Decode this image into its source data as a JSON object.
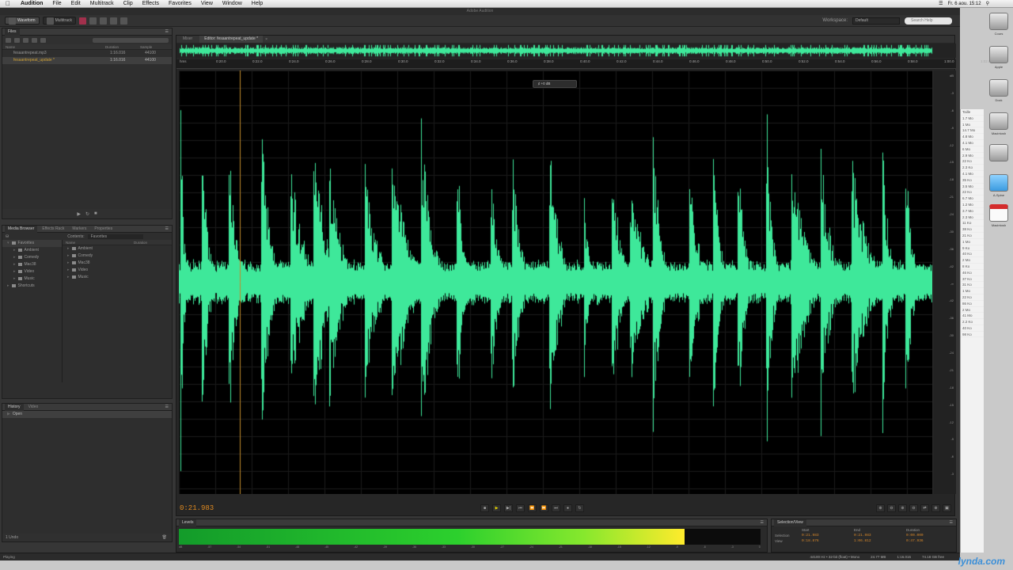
{
  "menubar": {
    "app": "Audition",
    "items": [
      "File",
      "Edit",
      "Multitrack",
      "Clip",
      "Effects",
      "Favorites",
      "View",
      "Window",
      "Help"
    ],
    "clock": "Fr. 6 aou. 15:12"
  },
  "window": {
    "title": "Adobe Audition"
  },
  "toolbar": {
    "waveform": "Waveform",
    "multitrack": "Multitrack",
    "workspace_label": "Workspace:",
    "workspace": "Default",
    "search_placeholder": "Search Help"
  },
  "files": {
    "title": "Files",
    "columns": {
      "name": "Name",
      "duration": "Duration",
      "rate": "Sample"
    },
    "rows": [
      {
        "name": "fesaantrepeat.mp3",
        "duration": "1:16.016",
        "rate": "44100"
      },
      {
        "name": "fesaantrepeat_update *",
        "duration": "1:16.016",
        "rate": "44100"
      }
    ]
  },
  "browser": {
    "tabs": [
      "Media Browser",
      "Effects Rack",
      "Markers",
      "Properties"
    ],
    "contents_label": "Contents:",
    "contents_value": "Favorites",
    "col_name": "Name",
    "col_duration": "Duration",
    "left_tree": [
      "Favorites",
      "Ambient",
      "Comedy",
      "Mac38",
      "Video",
      "Music",
      "Shortcuts"
    ],
    "right_list": [
      "Ambient",
      "Comedy",
      "Mac38",
      "Video",
      "Music"
    ]
  },
  "history": {
    "tabs": [
      "History",
      "Video"
    ],
    "items": [
      "Open"
    ],
    "undo_count": "1 Undo"
  },
  "editor": {
    "tabs": [
      "Mixer",
      "Editor: fesaantrepeat_update *"
    ],
    "ruler": [
      "hms",
      "0:20.0",
      "0:22.0",
      "0:24.0",
      "0:26.0",
      "0:28.0",
      "0:30.0",
      "0:32.0",
      "0:34.0",
      "0:36.0",
      "0:38.0",
      "0:40.0",
      "0:42.0",
      "0:44.0",
      "0:46.0",
      "0:48.0",
      "0:50.0",
      "0:52.0",
      "0:54.0",
      "0:56.0",
      "0:58.0",
      "1:00.0",
      "1:02.0",
      "1:04.0",
      "1:06.0"
    ],
    "hud": "+0 dB",
    "db_scale": [
      "dB",
      "-3",
      "-6",
      "-9",
      "-12",
      "-15",
      "-18",
      "-21",
      "-24",
      "-30",
      "-36",
      "-42",
      "-∞",
      "-42",
      "-36",
      "-30",
      "-24",
      "-21",
      "-18",
      "-15",
      "-12",
      "-9",
      "-6",
      "-3"
    ],
    "wave_color": "#3ee89a"
  },
  "transport": {
    "timecode": "0:21.983",
    "buttons": [
      "■",
      "▶",
      "▶|",
      "⏮",
      "⏪",
      "⏩",
      "⏭",
      "●",
      "↻"
    ]
  },
  "levels": {
    "title": "Levels",
    "fill_fraction": 0.87,
    "scale": [
      "dB",
      "-57",
      "-54",
      "-51",
      "-48",
      "-45",
      "-42",
      "-39",
      "-36",
      "-33",
      "-30",
      "-27",
      "-24",
      "-21",
      "-18",
      "-15",
      "-12",
      "-9",
      "-6",
      "-3",
      "0"
    ]
  },
  "selection": {
    "title": "Selection/View",
    "headers": [
      "",
      "Start",
      "End",
      "Duration"
    ],
    "rows": [
      {
        "label": "Selection",
        "start": "0:21.983",
        "end": "0:21.983",
        "duration": "0:00.000"
      },
      {
        "label": "View",
        "start": "0:18.876",
        "end": "1:06.812",
        "duration": "0:47.936"
      }
    ]
  },
  "status": {
    "left": "Playing",
    "format": "44100 Hz • 32-bit (float) • Mono",
    "size": "24.77 MB",
    "duration": "1:16.016",
    "free": "74.18 GB free"
  },
  "dock": {
    "labels": [
      "Cours",
      "Apple",
      "Dock",
      "Macintosh",
      "A-Spine",
      "Macintosh"
    ]
  },
  "bg_list": [
    "Taille",
    "1.7 Mo",
    "1 Mo",
    "14.7 Mo",
    "4.8 Mo",
    "4.1 Mo",
    "6 Mo",
    "2.9 Mo",
    "22 Ko",
    "2.3 Ko",
    "4.1 Mo",
    "35 Ko",
    "3.5 Mo",
    "22 Ko",
    "6.7 Mo",
    "1.2 Mo",
    "3.7 Mo",
    "2.3 Mo",
    "11 Ko",
    "38 Ko",
    "21 Ko",
    "1 Mo",
    "9 Ko",
    "40 Ko",
    "2 Mo",
    "8 Ko",
    "46 Ko",
    "37 Ko",
    "31 Ko",
    "1 Mo",
    "22 Ko",
    "86 Ko",
    "2 Mo",
    "41 Mo",
    "2.2 Ko",
    "40 Ko",
    "98 Ko"
  ],
  "watermark": "lynda.com"
}
